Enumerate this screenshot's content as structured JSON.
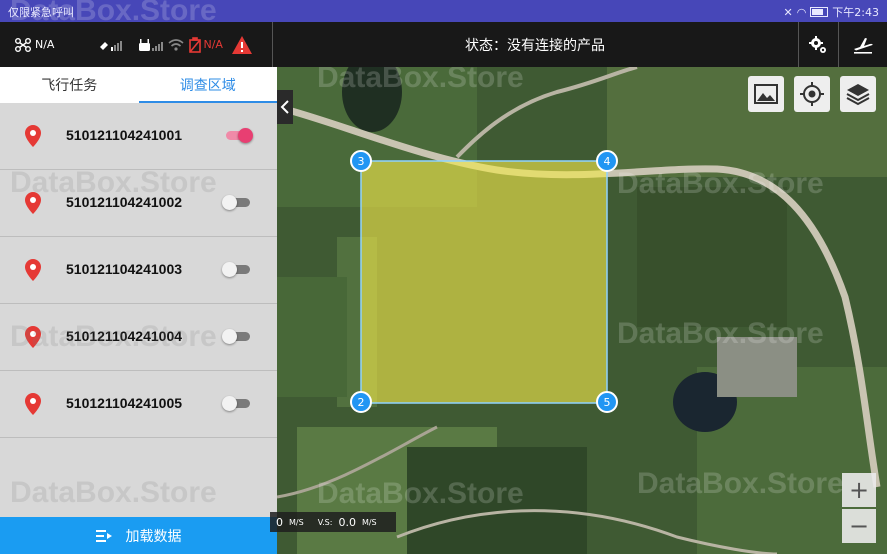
{
  "status_bar": {
    "left_text": "仅限紧急呼叫",
    "time": "下午2:43"
  },
  "top_bar": {
    "aircraft_value": "N/A",
    "battery_value": "N/A",
    "status_text": "状态：没有连接的产品"
  },
  "tabs": [
    {
      "label": "飞行任务",
      "active": false
    },
    {
      "label": "调查区域",
      "active": true
    }
  ],
  "survey_areas": [
    {
      "id": "510121104241001",
      "enabled": true
    },
    {
      "id": "510121104241002",
      "enabled": false
    },
    {
      "id": "510121104241003",
      "enabled": false
    },
    {
      "id": "510121104241004",
      "enabled": false
    },
    {
      "id": "510121104241005",
      "enabled": false
    }
  ],
  "load_button": {
    "label": "加载数据"
  },
  "telemetry": {
    "hs_value": "0",
    "hs_unit": "M/S",
    "vs_label": "V.S:",
    "vs_value": "0.0",
    "vs_unit": "M/S"
  },
  "map": {
    "vertices": [
      "2",
      "3",
      "4",
      "5"
    ],
    "zoom_in": "+",
    "zoom_out": "−"
  },
  "watermark": "DataBox.Store",
  "colors": {
    "accent": "#2e8ce6",
    "button_bg": "#1a9cf2",
    "toggle_on": "#e83f72",
    "polygon_fill": "#f2e84a",
    "vertex": "#2196f3",
    "status_bar": "#4747b8"
  }
}
